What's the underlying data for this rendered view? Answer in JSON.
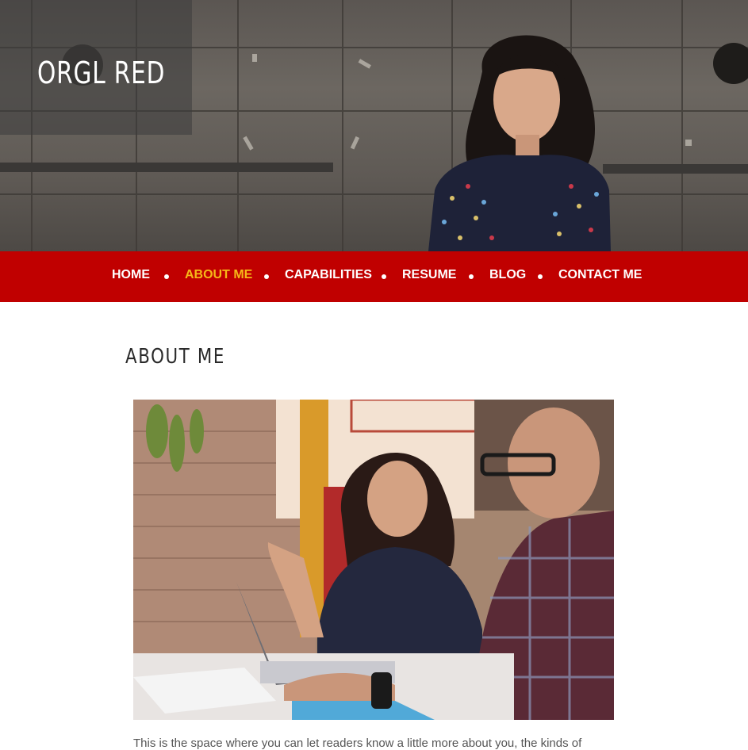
{
  "site": {
    "title": "ORGL RED"
  },
  "nav": {
    "items": [
      {
        "label": "HOME",
        "active": false
      },
      {
        "label": "ABOUT ME",
        "active": true
      },
      {
        "label": "CAPABILITIES",
        "active": false
      },
      {
        "label": "RESUME",
        "active": false
      },
      {
        "label": "BLOG",
        "active": false
      },
      {
        "label": "CONTACT ME",
        "active": false
      }
    ]
  },
  "page": {
    "heading": "ABOUT ME",
    "intro": "This is the space where you can let readers know a little more about you, the kinds of"
  },
  "colors": {
    "nav_background": "#c00000",
    "nav_text": "#ffffff",
    "nav_active": "#f6b818",
    "heading": "#2a2a2a",
    "body_text": "#555555"
  },
  "images": {
    "hero": "woman-portrait-against-metal-wall",
    "about": "two-people-working-at-laptop"
  }
}
